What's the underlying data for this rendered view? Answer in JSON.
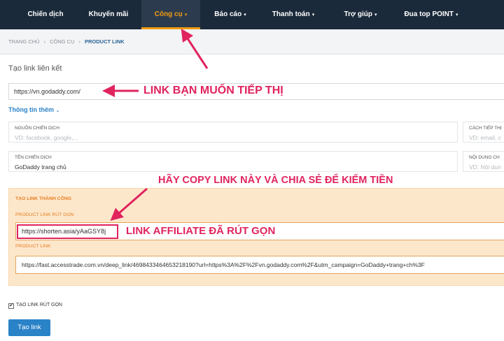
{
  "nav": {
    "items": [
      {
        "label": "Chiến dịch",
        "caret": ""
      },
      {
        "label": "Khuyến mãi",
        "caret": ""
      },
      {
        "label": "Công cụ",
        "caret": "▾"
      },
      {
        "label": "Báo cáo",
        "caret": "▾"
      },
      {
        "label": "Thanh toán",
        "caret": "▾"
      },
      {
        "label": "Trợ giúp",
        "caret": "▾"
      },
      {
        "label": "Đua top POINT",
        "caret": "▾"
      }
    ],
    "active_index": 2
  },
  "breadcrumb": {
    "home": "TRANG CHỦ",
    "parent": "CÔNG CỤ",
    "current": "PRODUCT LINK",
    "separator": "›"
  },
  "form": {
    "section_title": "Tạo link liên kết",
    "url_value": "https://vn.godaddy.com/",
    "more_info": "Thông tin thêm",
    "more_info_icon": "chevron-down",
    "fields": [
      {
        "label": "NGUỒN CHIẾN DỊCH",
        "value": "VD: facebook, google,...",
        "placeholder": true
      },
      {
        "label": "CÁCH TIẾP THỊ",
        "value": "VD: email, c",
        "placeholder": true
      },
      {
        "label": "TÊN CHIẾN DỊCH",
        "value": "GoDaddy trang chủ",
        "placeholder": false
      },
      {
        "label": "NỘI DUNG CH",
        "value": "VD: Nội dun",
        "placeholder": true
      }
    ]
  },
  "result": {
    "success_title": "TẠO LINK THÀNH CÔNG",
    "short_label": "PRODUCT LINK RÚT GỌN",
    "short_value": "https://shorten.asia/yAaGSY8j",
    "long_label": "PRODUCT LINK",
    "long_value": "https://fast.accesstrade.com.vn/deep_link/4698433464653218190?url=https%3A%2F%2Fvn.godaddy.com%2F&utm_campaign=GoDaddy+trang+ch%3F"
  },
  "options": {
    "checkbox_label": "TẠO LINK RÚT GỌN",
    "checkbox_checked": true,
    "checkbox_mark": "✔",
    "submit_label": "Tạo link"
  },
  "annotations": {
    "link_to_market": "LINK BẠN MUỐN TIẾP THỊ",
    "copy_share": "HÃY COPY LINK NÀY VÀ CHIA SẺ ĐỂ KIẾM TIỀN",
    "short_affiliate": "LINK AFFILIATE ĐÃ RÚT GỌN"
  },
  "colors": {
    "nav_bg": "#1b2a3a",
    "accent_orange": "#f39c12",
    "link_blue": "#2a82c7",
    "success_bg": "#fde7cb",
    "annotation_red": "#e0245e"
  }
}
